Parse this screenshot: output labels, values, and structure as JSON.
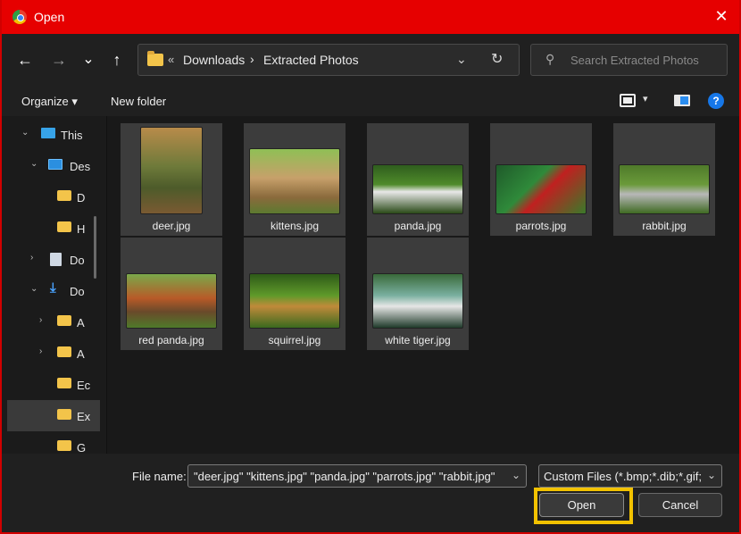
{
  "window": {
    "title": "Open",
    "close_glyph": "✕"
  },
  "nav": {
    "back_icon": "←",
    "forward_icon": "→",
    "recent_icon": "⌄",
    "up_icon": "↑",
    "address": {
      "overflow": "«",
      "crumbs": [
        "Downloads",
        "Extracted Photos"
      ],
      "separator": "›",
      "dropdown_icon": "⌄",
      "refresh_icon": "↻"
    },
    "search": {
      "icon": "⚲",
      "placeholder": "Search Extracted Photos"
    }
  },
  "toolbar": {
    "organize": "Organize ▾",
    "new_folder": "New folder",
    "view_dd": "▾",
    "help": "?"
  },
  "sidebar": {
    "items": [
      {
        "label": "This",
        "arrow": "⌄",
        "icon": "pc"
      },
      {
        "label": "Des",
        "arrow": "⌄",
        "icon": "desk"
      },
      {
        "label": "D",
        "arrow": "",
        "icon": "folder"
      },
      {
        "label": "H",
        "arrow": "",
        "icon": "folder"
      },
      {
        "label": "Do",
        "arrow": "›",
        "icon": "doc"
      },
      {
        "label": "Do",
        "arrow": "⌄",
        "icon": "down"
      },
      {
        "label": "A",
        "arrow": "›",
        "icon": "folder"
      },
      {
        "label": "A",
        "arrow": "›",
        "icon": "folder"
      },
      {
        "label": "Ec",
        "arrow": "",
        "icon": "folder"
      },
      {
        "label": "Ex",
        "arrow": "",
        "icon": "folder",
        "selected": true
      },
      {
        "label": "G",
        "arrow": "",
        "icon": "folder"
      }
    ]
  },
  "files": [
    {
      "name": "deer.jpg",
      "gradient": "linear-gradient(180deg,#b88b4a 0%,#6e7a3a 45%,#4d5b2a 70%,#7a5a32 100%)"
    },
    {
      "name": "kittens.jpg",
      "gradient": "linear-gradient(180deg,#8fbf55 0%,#c7a06a 45%,#8a6a3c 75%,#5c7a30 100%)"
    },
    {
      "name": "panda.jpg",
      "gradient": "linear-gradient(180deg,#2f5e1e 0%,#4f8a2a 40%,#e8e8e8 55%,#2a4a18 100%)"
    },
    {
      "name": "parrots.jpg",
      "gradient": "linear-gradient(135deg,#1f5a2a 0%,#2f8a3a 40%,#c02020 55%,#3a7a2a 100%)"
    },
    {
      "name": "rabbit.jpg",
      "gradient": "linear-gradient(180deg,#4f7a2a 0%,#6a9a3a 40%,#b8b8b8 60%,#3f6a22 100%)"
    },
    {
      "name": "red panda.jpg",
      "gradient": "linear-gradient(180deg,#7aa84a 0%,#b85a28 45%,#6a4a2a 70%,#4f7a2a 100%)"
    },
    {
      "name": "squirrel.jpg",
      "gradient": "linear-gradient(180deg,#2e5a18 0%,#5f9a2a 40%,#c08a3a 60%,#3a6a1e 100%)"
    },
    {
      "name": "white tiger.jpg",
      "gradient": "linear-gradient(180deg,#3a6a3a 0%,#7ab0a0 40%,#e6e6e6 60%,#1f3a2a 100%)"
    }
  ],
  "footer": {
    "file_name_label": "File name:",
    "file_name_value": "\"deer.jpg\" \"kittens.jpg\" \"panda.jpg\" \"parrots.jpg\" \"rabbit.jpg\"",
    "file_type_value": "Custom Files (*.bmp;*.dib;*.gif;",
    "dropdown_icon": "⌄",
    "open_label": "Open",
    "cancel_label": "Cancel"
  },
  "colors": {
    "titlebar": "#e60000",
    "highlight": "#f2c200",
    "accent": "#1677e8"
  }
}
